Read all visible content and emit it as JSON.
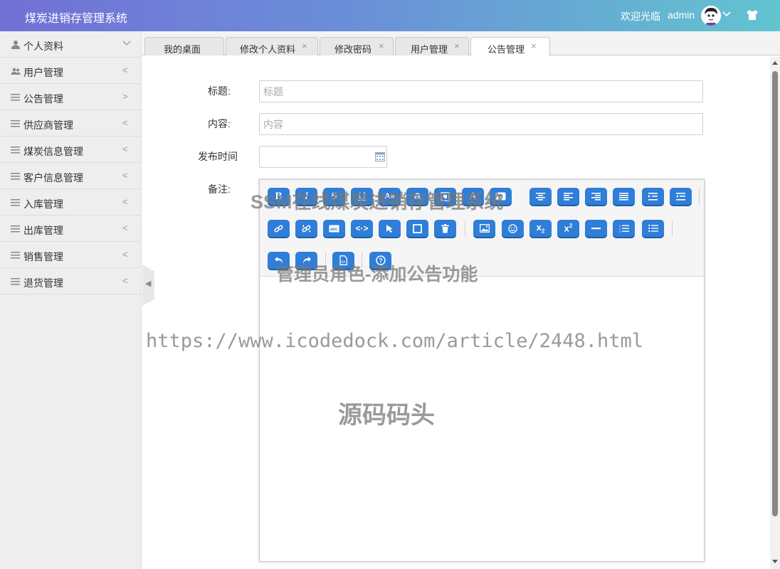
{
  "header": {
    "app_title": "煤炭进销存管理系统",
    "welcome": "欢迎光临",
    "username": "admin",
    "accent_start": "#7270d6",
    "accent_end": "#62c4cf"
  },
  "sidebar": {
    "items": [
      {
        "label": "个人资料",
        "icon": "user-icon",
        "arrow": "chevron-down"
      },
      {
        "label": "用户管理",
        "icon": "users-icon",
        "arrow": "<"
      },
      {
        "label": "公告管理",
        "icon": "menu-lines-icon",
        "arrow": ">"
      },
      {
        "label": "供应商管理",
        "icon": "menu-lines-icon",
        "arrow": "<"
      },
      {
        "label": "煤炭信息管理",
        "icon": "menu-lines-icon",
        "arrow": "<"
      },
      {
        "label": "客户信息管理",
        "icon": "menu-lines-icon",
        "arrow": "<"
      },
      {
        "label": "入库管理",
        "icon": "menu-lines-icon",
        "arrow": "<"
      },
      {
        "label": "出库管理",
        "icon": "menu-lines-icon",
        "arrow": "<"
      },
      {
        "label": "销售管理",
        "icon": "menu-lines-icon",
        "arrow": "<"
      },
      {
        "label": "退货管理",
        "icon": "menu-lines-icon",
        "arrow": "<"
      }
    ]
  },
  "tabs": [
    {
      "label": "我的桌面",
      "closable": false
    },
    {
      "label": "修改个人资料",
      "closable": true
    },
    {
      "label": "修改密码",
      "closable": true
    },
    {
      "label": "用户管理",
      "closable": true
    },
    {
      "label": "公告管理",
      "closable": true,
      "active": true
    }
  ],
  "tab_close_glyph": "×",
  "form": {
    "title_label": "标题:",
    "title_placeholder": "标题",
    "title_value": "",
    "content_label": "内容:",
    "content_placeholder": "内容",
    "content_value": "",
    "publish_time_label": "发布时间",
    "publish_time_value": "",
    "remark_label": "备注:"
  },
  "editor": {
    "button_color": "#2f7ed8",
    "row1": [
      "bold",
      "italic",
      "strikethrough",
      "underline",
      "font-size",
      "font-family",
      "insert-code",
      "font-color",
      "background-color",
      "align-center",
      "align-left",
      "align-right",
      "justify",
      "indent",
      "outdent"
    ],
    "row2": [
      "link",
      "unlink",
      "anchor",
      "html-source",
      "select",
      "table",
      "clear",
      "image",
      "emoji",
      "subscript",
      "superscript",
      "horizontal-rule",
      "ordered-list",
      "unordered-list"
    ],
    "row3": [
      "undo",
      "redo",
      "template",
      "help"
    ]
  },
  "watermarks": {
    "line1": "SSM在线煤炭进销存管理系统",
    "line2": "管理员角色-添加公告功能",
    "line3": "https://www.icodedock.com/article/2448.html",
    "line4": "源码码头"
  }
}
